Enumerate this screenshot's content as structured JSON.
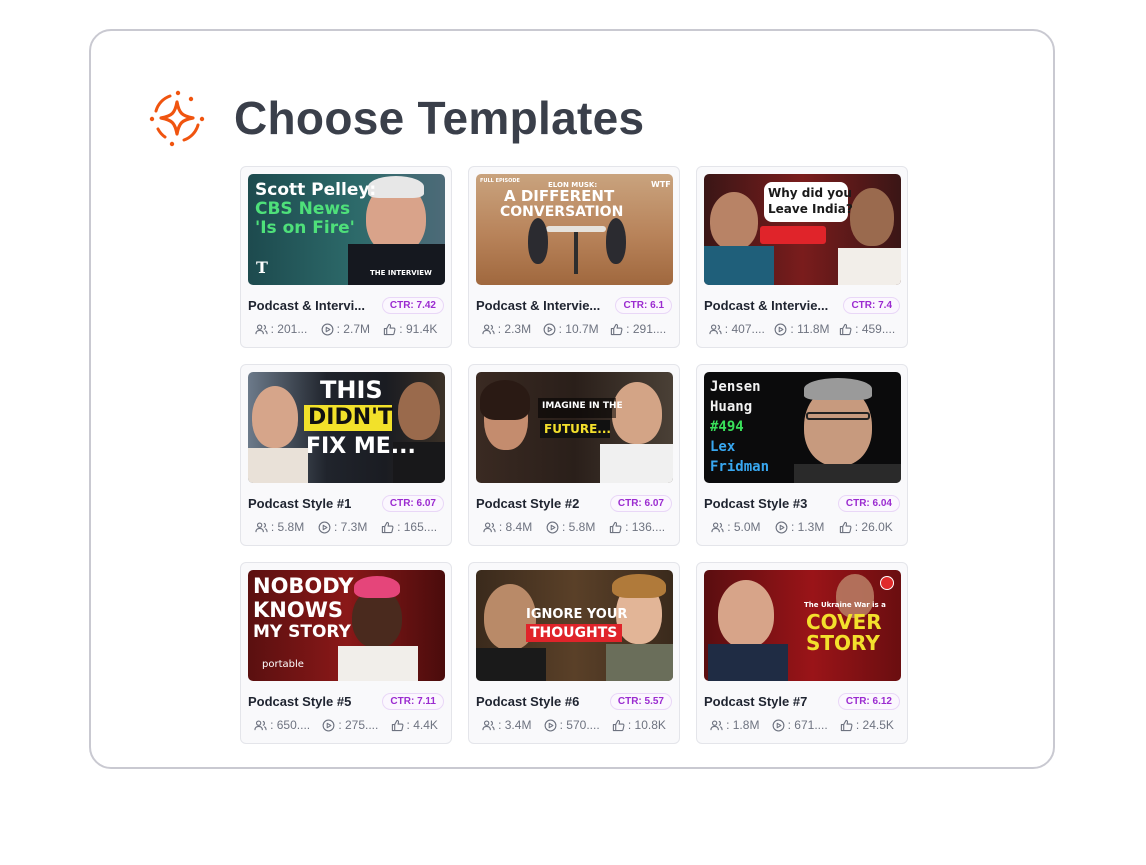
{
  "header": {
    "title": "Choose Templates",
    "icon": "sparkle-icon",
    "accent_color": "#f0540f"
  },
  "templates": [
    {
      "name": "Podcast & Intervi...",
      "ctr": "CTR: 7.42",
      "subscribers": ": 201...",
      "views": ": 2.7M",
      "likes": ": 91.4K",
      "thumb": {
        "lines": [
          "Scott Pelley:",
          "CBS News",
          "'Is on Fire'"
        ],
        "tag": "THE INTERVIEW",
        "logo": "T"
      }
    },
    {
      "name": "Podcast & Intervie...",
      "ctr": "CTR: 6.1",
      "subscribers": ": 2.3M",
      "views": ": 10.7M",
      "likes": ": 291....",
      "thumb": {
        "lines": [
          "ELON MUSK:",
          "A DIFFERENT",
          "CONVERSATION"
        ],
        "tag": "FULL EPISODE",
        "logo": "WTF"
      }
    },
    {
      "name": "Podcast & Intervie...",
      "ctr": "CTR: 7.4",
      "subscribers": ": 407....",
      "views": ": 11.8M",
      "likes": ": 459....",
      "thumb": {
        "lines": [
          "Why did you",
          "Leave India?"
        ]
      }
    },
    {
      "name": "Podcast Style #1",
      "ctr": "CTR: 6.07",
      "subscribers": ": 5.8M",
      "views": ": 7.3M",
      "likes": ": 165....",
      "thumb": {
        "lines": [
          "THIS",
          "DIDN'T",
          "FIX ME..."
        ]
      }
    },
    {
      "name": "Podcast Style #2",
      "ctr": "CTR: 6.07",
      "subscribers": ": 8.4M",
      "views": ": 5.8M",
      "likes": ": 136....",
      "thumb": {
        "lines": [
          "IMAGINE IN THE",
          "FUTURE..."
        ]
      }
    },
    {
      "name": "Podcast Style #3",
      "ctr": "CTR: 6.04",
      "subscribers": ": 5.0M",
      "views": ": 1.3M",
      "likes": ": 26.0K",
      "thumb": {
        "lines": [
          "Jensen",
          "Huang",
          "#494",
          "Lex",
          "Fridman"
        ]
      }
    },
    {
      "name": "Podcast Style #5",
      "ctr": "CTR: 7.11",
      "subscribers": ": 650....",
      "views": ": 275....",
      "likes": ": 4.4K",
      "thumb": {
        "lines": [
          "NOBODY",
          "KNOWS",
          "MY STORY"
        ],
        "tag": "portable"
      }
    },
    {
      "name": "Podcast Style #6",
      "ctr": "CTR: 5.57",
      "subscribers": ": 3.4M",
      "views": ": 570....",
      "likes": ": 10.8K",
      "thumb": {
        "lines": [
          "IGNORE YOUR",
          "THOUGHTS"
        ]
      }
    },
    {
      "name": "Podcast Style #7",
      "ctr": "CTR: 6.12",
      "subscribers": ": 1.8M",
      "views": ": 671....",
      "likes": ": 24.5K",
      "thumb": {
        "lines": [
          "The Ukraine War is a",
          "COVER",
          "STORY"
        ]
      }
    }
  ],
  "stat_icons": [
    "users-icon",
    "play-circle-icon",
    "thumbs-up-icon"
  ]
}
